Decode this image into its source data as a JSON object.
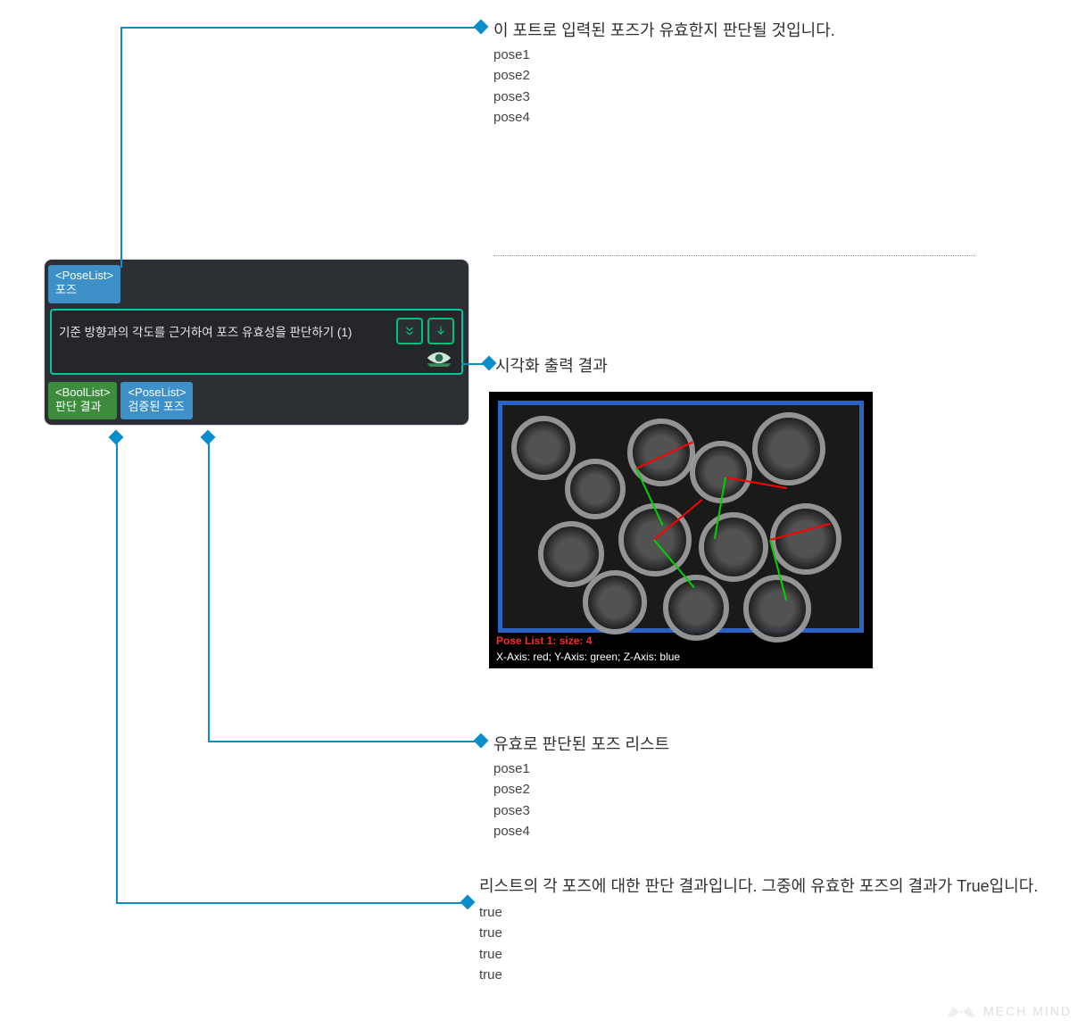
{
  "colors": {
    "line": "#0a8ecb",
    "port_blue": "#3e90c8",
    "port_green": "#3d8c3d",
    "node_accent": "#00c8a0"
  },
  "node": {
    "title": "기준 방향과의 각도를 근거하여 포즈 유효성을 판단하기 (1)",
    "input_port": {
      "type": "<PoseList>",
      "label": "포즈"
    },
    "output_port_bool": {
      "type": "<BoolList>",
      "label": "판단 결과"
    },
    "output_port_pose": {
      "type": "<PoseList>",
      "label": "검증된 포즈"
    },
    "btn_expand_name": "expand-icon",
    "btn_down_name": "download-icon",
    "eye_name": "visualize-icon"
  },
  "ann_input": {
    "title": "이 포트로 입력된 포즈가 유효한지 판단될 것입니다.",
    "items": [
      "pose1",
      "pose2",
      "pose3",
      "pose4"
    ]
  },
  "ann_viz_label": "시각화 출력 결과",
  "viz_overlay": {
    "line1": "Pose List 1: size: 4",
    "line2": "X-Axis: red; Y-Axis: green; Z-Axis: blue"
  },
  "ann_valid_pose": {
    "title": "유효로 판단된 포즈 리스트",
    "items": [
      "pose1",
      "pose2",
      "pose3",
      "pose4"
    ]
  },
  "ann_bool": {
    "title": "리스트의 각 포즈에 대한 판단 결과입니다. 그중에 유효한 포즈의 결과가 True입니다.",
    "items": [
      "true",
      "true",
      "true",
      "true"
    ]
  },
  "logo_text": "MECH MIND"
}
